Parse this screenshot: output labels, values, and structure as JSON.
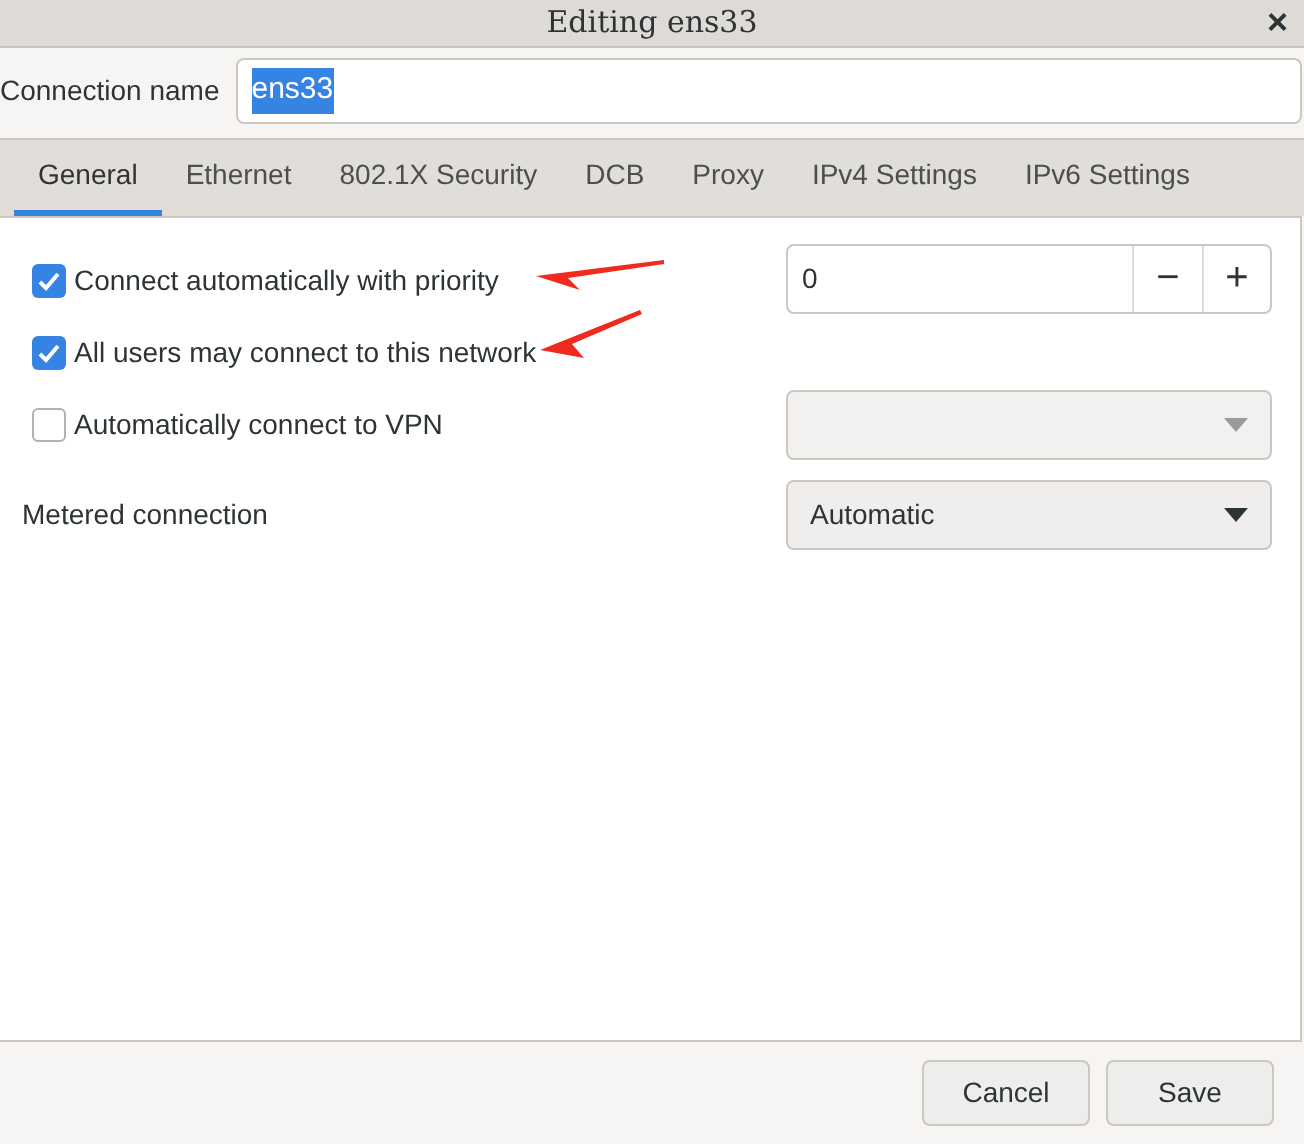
{
  "window": {
    "title": "Editing ens33",
    "close": "×"
  },
  "connection_name": {
    "label": "Connection name",
    "value": "ens33",
    "selected_text": true
  },
  "tabs": [
    {
      "label": "General",
      "selected": true
    },
    {
      "label": "Ethernet",
      "selected": false
    },
    {
      "label": "802.1X Security",
      "selected": false
    },
    {
      "label": "DCB",
      "selected": false
    },
    {
      "label": "Proxy",
      "selected": false
    },
    {
      "label": "IPv4 Settings",
      "selected": false
    },
    {
      "label": "IPv6 Settings",
      "selected": false
    }
  ],
  "options": [
    {
      "label": "Connect automatically with priority",
      "checked": true
    },
    {
      "label": "All users may connect to this network",
      "checked": true
    },
    {
      "label": "Automatically connect to VPN",
      "checked": false
    }
  ],
  "priority": {
    "value": "0",
    "minus": "−",
    "plus": "+"
  },
  "vpn_combo": {
    "disabled": true
  },
  "metered": {
    "label": "Metered connection",
    "value": "Automatic",
    "disabled": false
  },
  "annotations": [
    {
      "kind": "arrow"
    },
    {
      "kind": "arrow"
    }
  ],
  "buttons": [
    "Cancel",
    "Save"
  ]
}
